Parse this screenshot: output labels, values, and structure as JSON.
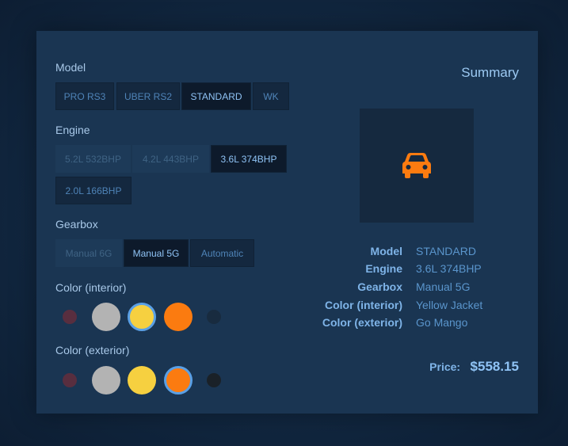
{
  "model": {
    "title": "Model",
    "options": [
      "PRO RS3",
      "UBER RS2",
      "STANDARD",
      "WK"
    ],
    "selected": "STANDARD"
  },
  "engine": {
    "title": "Engine",
    "options": [
      "5.2L 532BHP",
      "4.2L 443BHP",
      "3.6L 374BHP",
      "2.0L 166BHP"
    ],
    "selected": "3.6L 374BHP"
  },
  "gearbox": {
    "title": "Gearbox",
    "options": [
      "Manual 6G",
      "Manual 5G",
      "Automatic"
    ],
    "selected": "Manual 5G"
  },
  "color_interior": {
    "title": "Color (interior)",
    "swatches": [
      "#6e2c3a",
      "#b3b3b3",
      "#f6d040",
      "#fb7b10",
      "#18283a"
    ],
    "selected_index": 2
  },
  "color_exterior": {
    "title": "Color (exterior)",
    "swatches": [
      "#6e2c3a",
      "#b3b3b3",
      "#f6d040",
      "#fb7b10",
      "#1b1b1b"
    ],
    "selected_index": 3
  },
  "summary": {
    "title": "Summary",
    "icon": "car-icon",
    "icon_color": "#fb7b10",
    "rows": [
      {
        "label": "Model",
        "value": "STANDARD"
      },
      {
        "label": "Engine",
        "value": "3.6L 374BHP"
      },
      {
        "label": "Gearbox",
        "value": "Manual 5G"
      },
      {
        "label": "Color (interior)",
        "value": "Yellow Jacket"
      },
      {
        "label": "Color (exterior)",
        "value": "Go Mango"
      }
    ],
    "price_label": "Price:",
    "price_value": "$558.15"
  }
}
